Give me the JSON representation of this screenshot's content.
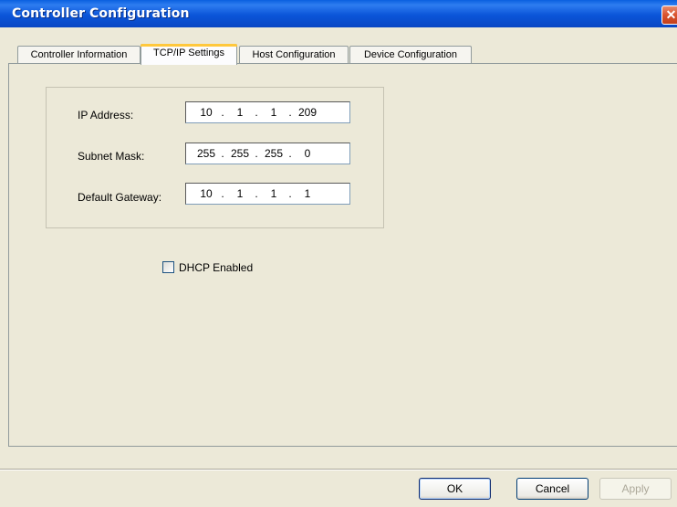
{
  "window": {
    "title": "Controller Configuration",
    "close_glyph": "✕"
  },
  "tabs": [
    {
      "label": "Controller Information",
      "active": false
    },
    {
      "label": "TCP/IP Settings",
      "active": true
    },
    {
      "label": "Host Configuration",
      "active": false
    },
    {
      "label": "Device Configuration",
      "active": false
    }
  ],
  "network": {
    "ip_address": {
      "label": "IP Address:",
      "octets": [
        "10",
        "1",
        "1",
        "209"
      ]
    },
    "subnet_mask": {
      "label": "Subnet Mask:",
      "octets": [
        "255",
        "255",
        "255",
        "0"
      ]
    },
    "default_gateway": {
      "label": "Default Gateway:",
      "octets": [
        "10",
        "1",
        "1",
        "1"
      ]
    },
    "separator": "."
  },
  "dhcp": {
    "label": "DHCP Enabled",
    "checked": false
  },
  "buttons": {
    "ok": "OK",
    "cancel": "Cancel",
    "apply": "Apply"
  },
  "colors": {
    "titlebar": "#0B55D9",
    "dialog_bg": "#ECE9D8",
    "active_tab_accent": "#FFC83C"
  }
}
